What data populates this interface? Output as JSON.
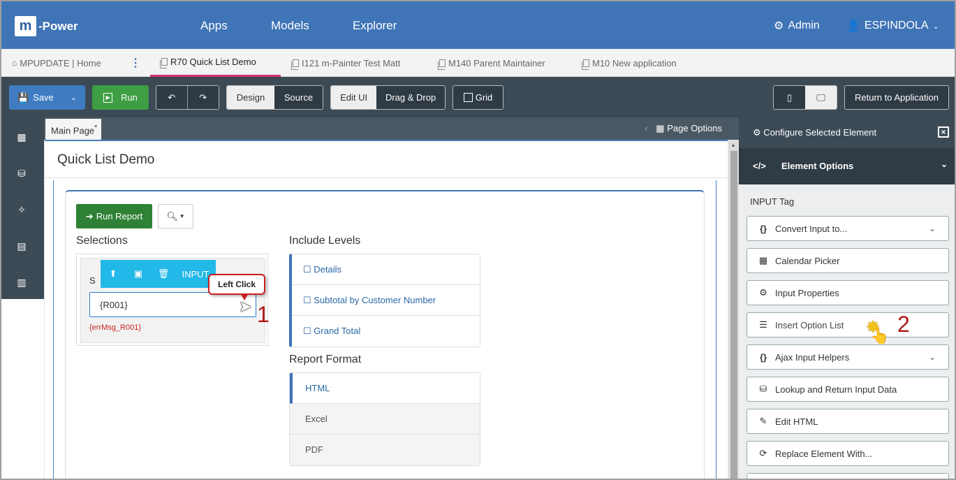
{
  "topnav": {
    "logo_letter": "m",
    "logo_text": "-Power",
    "links": [
      "Apps",
      "Models",
      "Explorer"
    ],
    "admin": "Admin",
    "user": "ESPINDOLA"
  },
  "tabs": [
    {
      "label": "MPUPDATE | Home"
    },
    {
      "label": "R70 Quick List Demo"
    },
    {
      "label": "I121 m-Painter Test Matt"
    },
    {
      "label": "M140 Parent Maintainer"
    },
    {
      "label": "M10 New application"
    }
  ],
  "toolbar": {
    "save": "Save",
    "run": "Run",
    "design": "Design",
    "source": "Source",
    "edit_ui": "Edit UI",
    "drag_drop": "Drag & Drop",
    "grid": "Grid",
    "return": "Return to Application"
  },
  "canvas": {
    "main_tab": "Main Page",
    "main_tab_marker": "*",
    "page_options": "Page Options",
    "page_title": "Quick List Demo",
    "run_report": "Run Report",
    "selections": "Selections",
    "selection_label_fragment": "S",
    "input_tool_label": "INPUT",
    "input_value": "{R001}",
    "error_msg": "{errMsg_R001}",
    "include_levels": "Include Levels",
    "levels": [
      "Details",
      "Subtotal by Customer Number",
      "Grand Total"
    ],
    "report_format": "Report Format",
    "formats": [
      "HTML",
      "Excel",
      "PDF"
    ]
  },
  "annotations": {
    "callout": "Left Click",
    "step1": "1",
    "step2": "2"
  },
  "right_panel": {
    "header": "Configure Selected Element",
    "element_options": "Element Options",
    "tag_label": "INPUT Tag",
    "options": [
      {
        "label": "Convert Input to...",
        "icon": "braces-icon"
      },
      {
        "label": "Calendar Picker",
        "icon": "calendar-icon"
      },
      {
        "label": "Input Properties",
        "icon": "gear-icon"
      },
      {
        "label": "Insert Option List",
        "icon": "list-icon"
      },
      {
        "label": "Ajax Input Helpers",
        "icon": "braces-icon"
      },
      {
        "label": "Lookup and Return Input Data",
        "icon": "database-icon"
      },
      {
        "label": "Edit HTML",
        "icon": "edit-icon"
      },
      {
        "label": "Replace Element With...",
        "icon": "refresh-icon"
      }
    ]
  },
  "colors": {
    "nav_blue": "#3f74b6",
    "toolbar_dark": "#3c4a55",
    "run_green": "#3d9e43",
    "input_tools_cyan": "#22b8e8",
    "annotation_red": "#b01818"
  }
}
